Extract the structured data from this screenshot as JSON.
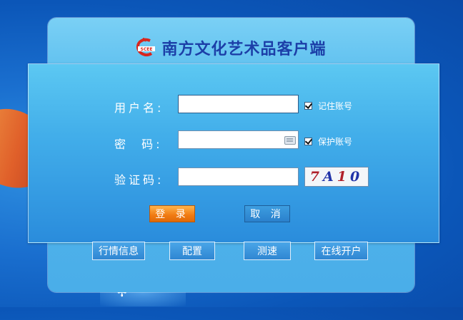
{
  "app": {
    "title": "南方文化艺术品客户端",
    "logo_text": "SCEE"
  },
  "form": {
    "username": {
      "label": "用户名:",
      "value": "",
      "placeholder": ""
    },
    "password": {
      "label": "密  码:",
      "value": "",
      "placeholder": ""
    },
    "captcha": {
      "label": "验证码:",
      "value": "",
      "placeholder": "",
      "image_chars": [
        "7",
        "A",
        "1",
        "0"
      ]
    },
    "remember_account": {
      "label": "记住账号",
      "checked": true
    },
    "protect_account": {
      "label": "保护账号",
      "checked": true
    },
    "login_button": "登 录",
    "cancel_button": "取 消"
  },
  "footer": {
    "buttons": [
      "行情信息",
      "配置",
      "测速",
      "在线开户"
    ]
  },
  "colors": {
    "title": "#1c3fa8",
    "login_button": "#f07a12",
    "panel": "#42aeea"
  }
}
